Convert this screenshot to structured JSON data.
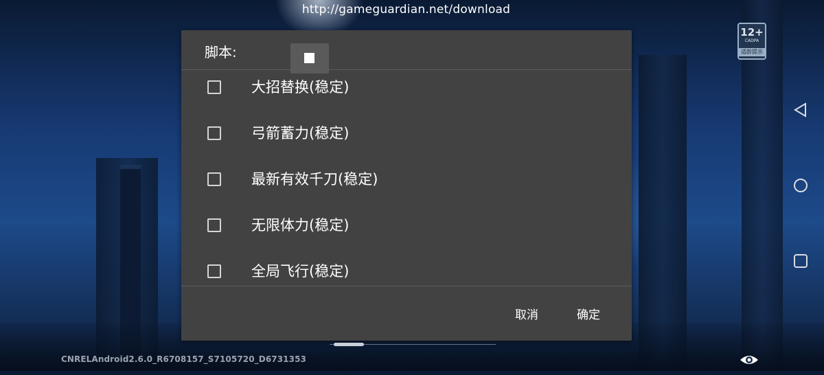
{
  "background": {
    "scene": "night sky game scene"
  },
  "overlay": {
    "url": "http://gameguardian.net/download",
    "build": "CNRELAndroid2.6.0_R6708157_S7105720_D6731353"
  },
  "age_badge": {
    "age": "12+",
    "brand": "CADPA",
    "note": "适龄提示"
  },
  "navigation": {
    "back_icon": "triangle-back-icon",
    "home_icon": "circle-home-icon",
    "recents_icon": "square-recents-icon"
  },
  "dialog": {
    "title": "脚本:",
    "stop_icon": "stop-icon",
    "items": [
      {
        "label": "大招替换(稳定)",
        "checked": false
      },
      {
        "label": "弓箭蓄力(稳定)",
        "checked": false
      },
      {
        "label": "最新有效千刀(稳定)",
        "checked": false
      },
      {
        "label": "无限体力(稳定)",
        "checked": false
      },
      {
        "label": "全局飞行(稳定)",
        "checked": false
      }
    ],
    "cancel_label": "取消",
    "ok_label": "确定"
  },
  "colors": {
    "dialog_bg": "#424242",
    "text": "#ffffff",
    "checkbox": "#d6d6d6"
  }
}
